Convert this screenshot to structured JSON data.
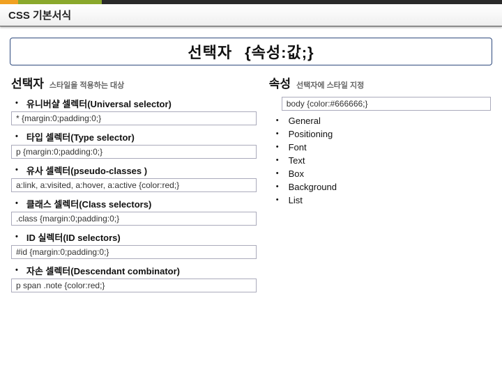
{
  "header": {
    "title": "CSS 기본서식"
  },
  "banner": {
    "left": "선택자",
    "right": "{속성:값;}"
  },
  "leftSection": {
    "title": "선택자",
    "subtitle": "스타일을 적용하는 대상",
    "items": [
      {
        "label": "유니버샬 셀렉터(Universal selector)",
        "code": "* {margin:0;padding:0;}"
      },
      {
        "label": "타입 셀렉터(Type selector)",
        "code": "p {margin:0;padding:0;}"
      },
      {
        "label": "유사 셀렉터(pseudo-classes )",
        "code": "a:link, a:visited, a:hover, a:active {color:red;}"
      },
      {
        "label": "클래스 셀렉터(Class selectors)",
        "code": ".class {margin:0;padding:0;}"
      },
      {
        "label": "ID 실렉터(ID selectors)",
        "code": "#id {margin:0;padding:0;}"
      },
      {
        "label": "자손 셀렉터(Descendant combinator)",
        "code": "p span .note {color:red;}"
      }
    ]
  },
  "rightSection": {
    "title": "속성",
    "subtitle": "선택자에 스타일 지정",
    "codebox": "body {color:#666666;}",
    "attrs": [
      "General",
      "Positioning",
      "Font",
      "Text",
      "Box",
      "Background",
      "List"
    ]
  }
}
